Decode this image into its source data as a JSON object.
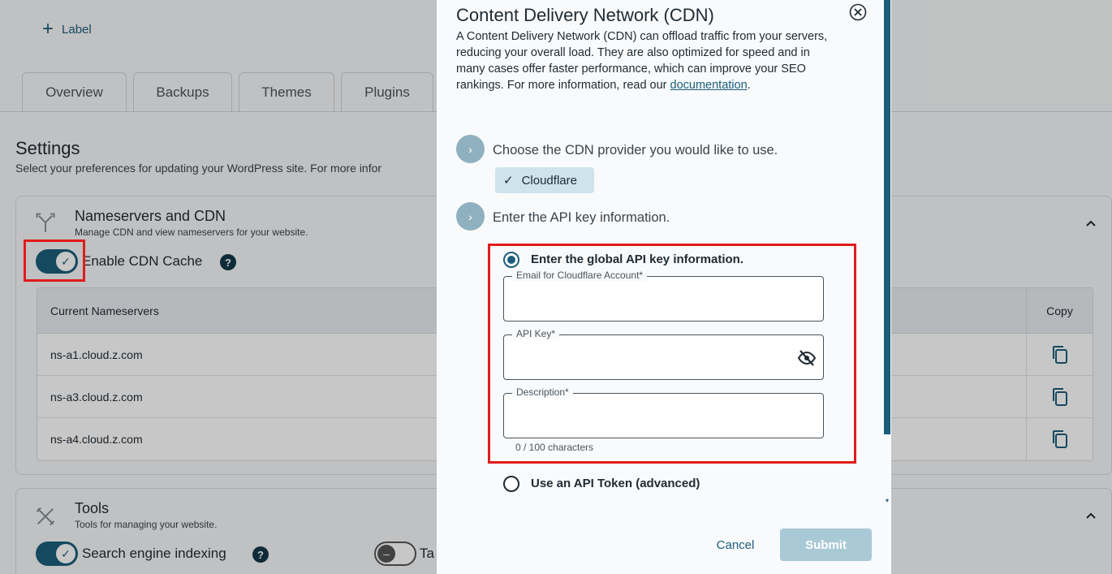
{
  "page": {
    "add_label": "Label",
    "tabs": [
      {
        "label": "Overview"
      },
      {
        "label": "Backups"
      },
      {
        "label": "Themes"
      },
      {
        "label": "Plugins"
      }
    ],
    "settings_title": "Settings",
    "settings_subtitle": "Select your preferences for updating your WordPress site. For more infor",
    "nameservers_card": {
      "title": "Nameservers and CDN",
      "subtitle": "Manage CDN and view nameservers for your website.",
      "cdn_toggle_label": "Enable CDN Cache",
      "cdn_toggle_on": true,
      "help": "?",
      "table": {
        "col_nameservers": "Current Nameservers",
        "col_copy": "Copy",
        "rows": [
          "ns-a1.cloud.z.com",
          "ns-a3.cloud.z.com",
          "ns-a4.cloud.z.com"
        ]
      }
    },
    "tools_card": {
      "title": "Tools",
      "subtitle": "Tools for managing your website.",
      "search_toggle_label": "Search engine indexing",
      "second_toggle_label": "Ta",
      "help": "?"
    }
  },
  "modal": {
    "title": "Content Delivery Network (CDN)",
    "description": "A Content Delivery Network (CDN) can offload traffic from your servers, reducing your overall load. They are also optimized for speed and in many cases offer faster performance, which can improve your SEO rankings. For more information, read our ",
    "doc_link": "documentation",
    "doc_suffix": ".",
    "step1": "Choose the CDN provider you would like to use.",
    "provider_chip": "Cloudflare",
    "step2": "Enter the API key information.",
    "option_global": "Enter the global API key information.",
    "email_label": "Email for Cloudflare Account*",
    "api_key_label": "API Key*",
    "description_label": "Description*",
    "char_counter": "0 / 100 characters",
    "option_token": "Use an API Token (advanced)",
    "cancel": "Cancel",
    "submit": "Submit"
  },
  "colors": {
    "accent": "#1b5e7a",
    "highlight": "#e01b1b",
    "submit_disabled": "#a9c9d6"
  }
}
